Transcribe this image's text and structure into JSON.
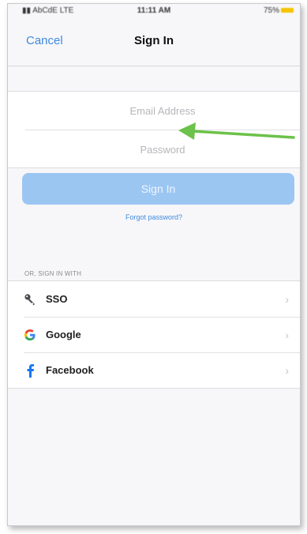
{
  "status_bar": {
    "carrier": "▮▮ AbCdE LTE",
    "time": "11:11 AM",
    "battery": "75%"
  },
  "header": {
    "cancel_label": "Cancel",
    "title": "Sign In"
  },
  "form": {
    "email_placeholder": "Email Address",
    "password_placeholder": "Password",
    "signin_label": "Sign In",
    "forgot_label": "Forgot password?"
  },
  "alt_signin": {
    "section_label": "OR, SIGN IN WITH",
    "providers": [
      {
        "label": "SSO",
        "icon": "key-icon"
      },
      {
        "label": "Google",
        "icon": "google-icon"
      },
      {
        "label": "Facebook",
        "icon": "facebook-icon"
      }
    ]
  },
  "colors": {
    "accent": "#3f8ae0",
    "button_disabled": "#9cc6f2",
    "annotation_arrow": "#6cc24a"
  }
}
